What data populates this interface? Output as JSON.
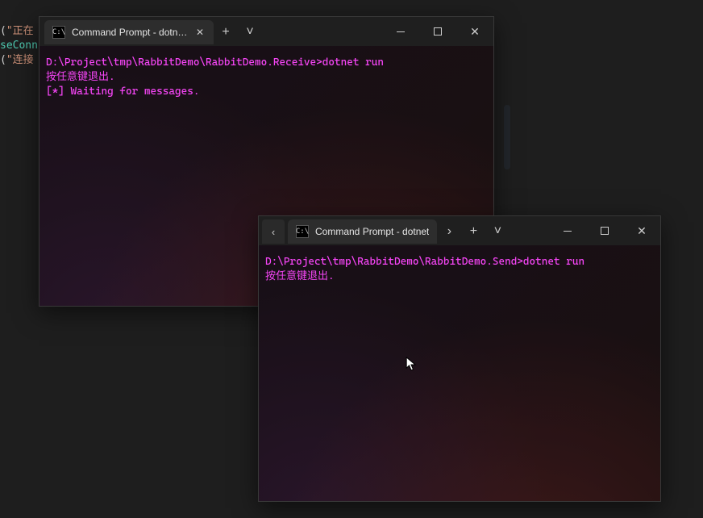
{
  "ide": {
    "line1_pre": "(",
    "line1_str": "\"正在",
    "line2": "seConn",
    "line3_pre": "(",
    "line3_str": "\"连接"
  },
  "window1": {
    "tab_title": "Command Prompt - dotnet  run",
    "lines": [
      "D:\\Project\\tmp\\RabbitDemo\\RabbitDemo.Receive>dotnet run",
      "按任意键退出.",
      " [*] Waiting for messages."
    ]
  },
  "window2": {
    "tab_title": "Command Prompt - dotnet",
    "lines": [
      "D:\\Project\\tmp\\RabbitDemo\\RabbitDemo.Send>dotnet run",
      "按任意键退出."
    ]
  }
}
